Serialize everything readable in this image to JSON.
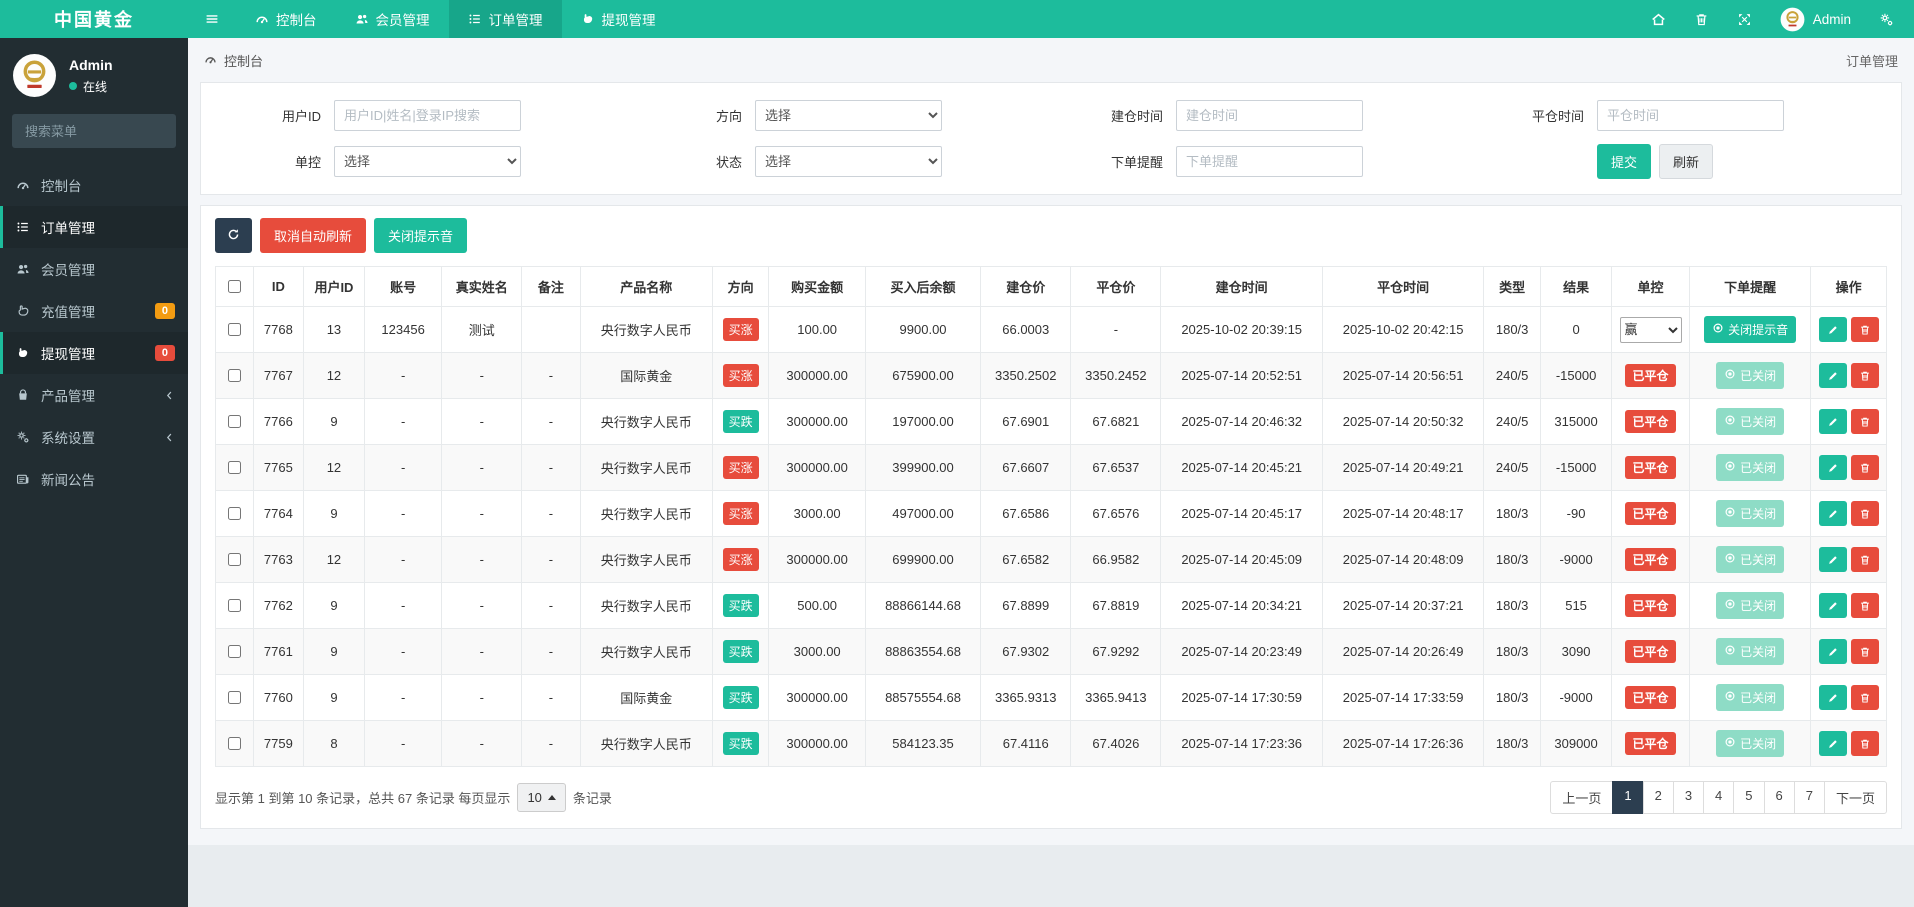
{
  "app": {
    "brand": "中国黄金"
  },
  "colors": {
    "accent": "#1dbc9c",
    "danger": "#e74c3c",
    "navy": "#2c3e50",
    "warning": "#f39c12"
  },
  "topnav": {
    "items": [
      {
        "name": "dashboard",
        "label": "控制台",
        "icon": "dashboard-icon",
        "active": false
      },
      {
        "name": "members",
        "label": "会员管理",
        "icon": "users-icon",
        "active": false
      },
      {
        "name": "orders",
        "label": "订单管理",
        "icon": "list-icon",
        "active": true
      },
      {
        "name": "withdraw",
        "label": "提现管理",
        "icon": "withdraw-icon",
        "active": false
      }
    ],
    "right_icons": [
      "home-icon",
      "trash-icon",
      "expand-icon"
    ],
    "admin": "Admin",
    "settings_icon": "gears-icon"
  },
  "sidebar": {
    "user": {
      "name": "Admin",
      "status": "在线"
    },
    "search_placeholder": "搜索菜单",
    "items": [
      {
        "name": "dashboard",
        "label": "控制台",
        "icon": "dashboard-icon"
      },
      {
        "name": "orders",
        "label": "订单管理",
        "icon": "list-icon",
        "active": true
      },
      {
        "name": "members",
        "label": "会员管理",
        "icon": "users-icon"
      },
      {
        "name": "recharge",
        "label": "充值管理",
        "icon": "recharge-icon",
        "badge": "0",
        "badge_color": "#f39c12"
      },
      {
        "name": "withdraw",
        "label": "提现管理",
        "icon": "withdraw-icon",
        "badge": "0",
        "badge_color": "#e74c3c",
        "active": true
      },
      {
        "name": "products",
        "label": "产品管理",
        "icon": "bag-icon",
        "expandable": true
      },
      {
        "name": "settings",
        "label": "系统设置",
        "icon": "gears-icon",
        "expandable": true
      },
      {
        "name": "news",
        "label": "新闻公告",
        "icon": "news-icon"
      }
    ]
  },
  "breadcrumb": {
    "left": "控制台",
    "right": "订单管理"
  },
  "filters": {
    "submit_label": "提交",
    "refresh_label": "刷新",
    "rows": [
      [
        {
          "name": "user-id",
          "label": "用户ID",
          "kind": "input",
          "placeholder": "用户ID|姓名|登录IP搜索"
        },
        {
          "name": "direction",
          "label": "方向",
          "kind": "select",
          "value": "选择"
        },
        {
          "name": "open-time",
          "label": "建仓时间",
          "kind": "input",
          "placeholder": "建仓时间"
        },
        {
          "name": "close-time",
          "label": "平仓时间",
          "kind": "input",
          "placeholder": "平仓时间"
        }
      ],
      [
        {
          "name": "control",
          "label": "单控",
          "kind": "select",
          "value": "选择"
        },
        {
          "name": "status",
          "label": "状态",
          "kind": "select",
          "value": "选择"
        },
        {
          "name": "order-remind",
          "label": "下单提醒",
          "kind": "input",
          "placeholder": "下单提醒"
        },
        {
          "kind": "buttons"
        }
      ]
    ]
  },
  "toolbar": {
    "auto_refresh_label": "取消自动刷新",
    "mute_label": "关闭提示音"
  },
  "table": {
    "headers": [
      "ID",
      "用户ID",
      "账号",
      "真实姓名",
      "备注",
      "产品名称",
      "方向",
      "购买金额",
      "买入后余额",
      "建仓价",
      "平仓价",
      "建仓时间",
      "平仓时间",
      "类型",
      "结果",
      "单控",
      "下单提醒",
      "操作"
    ],
    "rows": [
      {
        "id": "7768",
        "user_id": "13",
        "account": "123456",
        "real_name": "测试",
        "note": "",
        "product": "央行数字人民币",
        "direction": "买涨",
        "dir": "up",
        "amount": "100.00",
        "balance": "9900.00",
        "open_price": "66.0003",
        "close_price": "-",
        "open_time": "2025-10-02 20:39:15",
        "close_time": "2025-10-02 20:42:15",
        "type": "180/3",
        "result": "0",
        "control": {
          "kind": "select",
          "value": "赢"
        },
        "remind": {
          "kind": "button",
          "label": "关闭提示音"
        }
      },
      {
        "id": "7767",
        "user_id": "12",
        "account": "-",
        "real_name": "-",
        "note": "-",
        "product": "国际黄金",
        "direction": "买涨",
        "dir": "up",
        "amount": "300000.00",
        "balance": "675900.00",
        "open_price": "3350.2502",
        "close_price": "3350.2452",
        "open_time": "2025-07-14 20:52:51",
        "close_time": "2025-07-14 20:56:51",
        "type": "240/5",
        "result": "-15000",
        "control": {
          "kind": "badge",
          "value": "已平仓"
        },
        "remind": {
          "kind": "disabled",
          "label": "已关闭"
        }
      },
      {
        "id": "7766",
        "user_id": "9",
        "account": "-",
        "real_name": "-",
        "note": "-",
        "product": "央行数字人民币",
        "direction": "买跌",
        "dir": "down",
        "amount": "300000.00",
        "balance": "197000.00",
        "open_price": "67.6901",
        "close_price": "67.6821",
        "open_time": "2025-07-14 20:46:32",
        "close_time": "2025-07-14 20:50:32",
        "type": "240/5",
        "result": "315000",
        "control": {
          "kind": "badge",
          "value": "已平仓"
        },
        "remind": {
          "kind": "disabled",
          "label": "已关闭"
        }
      },
      {
        "id": "7765",
        "user_id": "12",
        "account": "-",
        "real_name": "-",
        "note": "-",
        "product": "央行数字人民币",
        "direction": "买涨",
        "dir": "up",
        "amount": "300000.00",
        "balance": "399900.00",
        "open_price": "67.6607",
        "close_price": "67.6537",
        "open_time": "2025-07-14 20:45:21",
        "close_time": "2025-07-14 20:49:21",
        "type": "240/5",
        "result": "-15000",
        "control": {
          "kind": "badge",
          "value": "已平仓"
        },
        "remind": {
          "kind": "disabled",
          "label": "已关闭"
        }
      },
      {
        "id": "7764",
        "user_id": "9",
        "account": "-",
        "real_name": "-",
        "note": "-",
        "product": "央行数字人民币",
        "direction": "买涨",
        "dir": "up",
        "amount": "3000.00",
        "balance": "497000.00",
        "open_price": "67.6586",
        "close_price": "67.6576",
        "open_time": "2025-07-14 20:45:17",
        "close_time": "2025-07-14 20:48:17",
        "type": "180/3",
        "result": "-90",
        "control": {
          "kind": "badge",
          "value": "已平仓"
        },
        "remind": {
          "kind": "disabled",
          "label": "已关闭"
        }
      },
      {
        "id": "7763",
        "user_id": "12",
        "account": "-",
        "real_name": "-",
        "note": "-",
        "product": "央行数字人民币",
        "direction": "买涨",
        "dir": "up",
        "amount": "300000.00",
        "balance": "699900.00",
        "open_price": "67.6582",
        "close_price": "66.9582",
        "open_time": "2025-07-14 20:45:09",
        "close_time": "2025-07-14 20:48:09",
        "type": "180/3",
        "result": "-9000",
        "control": {
          "kind": "badge",
          "value": "已平仓"
        },
        "remind": {
          "kind": "disabled",
          "label": "已关闭"
        }
      },
      {
        "id": "7762",
        "user_id": "9",
        "account": "-",
        "real_name": "-",
        "note": "-",
        "product": "央行数字人民币",
        "direction": "买跌",
        "dir": "down",
        "amount": "500.00",
        "balance": "88866144.68",
        "open_price": "67.8899",
        "close_price": "67.8819",
        "open_time": "2025-07-14 20:34:21",
        "close_time": "2025-07-14 20:37:21",
        "type": "180/3",
        "result": "515",
        "control": {
          "kind": "badge",
          "value": "已平仓"
        },
        "remind": {
          "kind": "disabled",
          "label": "已关闭"
        }
      },
      {
        "id": "7761",
        "user_id": "9",
        "account": "-",
        "real_name": "-",
        "note": "-",
        "product": "央行数字人民币",
        "direction": "买跌",
        "dir": "down",
        "amount": "3000.00",
        "balance": "88863554.68",
        "open_price": "67.9302",
        "close_price": "67.9292",
        "open_time": "2025-07-14 20:23:49",
        "close_time": "2025-07-14 20:26:49",
        "type": "180/3",
        "result": "3090",
        "control": {
          "kind": "badge",
          "value": "已平仓"
        },
        "remind": {
          "kind": "disabled",
          "label": "已关闭"
        }
      },
      {
        "id": "7760",
        "user_id": "9",
        "account": "-",
        "real_name": "-",
        "note": "-",
        "product": "国际黄金",
        "direction": "买跌",
        "dir": "down",
        "amount": "300000.00",
        "balance": "88575554.68",
        "open_price": "3365.9313",
        "close_price": "3365.9413",
        "open_time": "2025-07-14 17:30:59",
        "close_time": "2025-07-14 17:33:59",
        "type": "180/3",
        "result": "-9000",
        "control": {
          "kind": "badge",
          "value": "已平仓"
        },
        "remind": {
          "kind": "disabled",
          "label": "已关闭"
        }
      },
      {
        "id": "7759",
        "user_id": "8",
        "account": "-",
        "real_name": "-",
        "note": "-",
        "product": "央行数字人民币",
        "direction": "买跌",
        "dir": "down",
        "amount": "300000.00",
        "balance": "584123.35",
        "open_price": "67.4116",
        "close_price": "67.4026",
        "open_time": "2025-07-14 17:23:36",
        "close_time": "2025-07-14 17:26:36",
        "type": "180/3",
        "result": "309000",
        "control": {
          "kind": "badge",
          "value": "已平仓"
        },
        "remind": {
          "kind": "disabled",
          "label": "已关闭"
        }
      }
    ]
  },
  "footer": {
    "summary": "显示第 1 到第 10 条记录，总共 67 条记录 每页显示",
    "page_size": "10",
    "suffix": "条记录",
    "prev": "上一页",
    "next": "下一页",
    "pages": [
      "1",
      "2",
      "3",
      "4",
      "5",
      "6",
      "7"
    ],
    "active_page": "1"
  }
}
